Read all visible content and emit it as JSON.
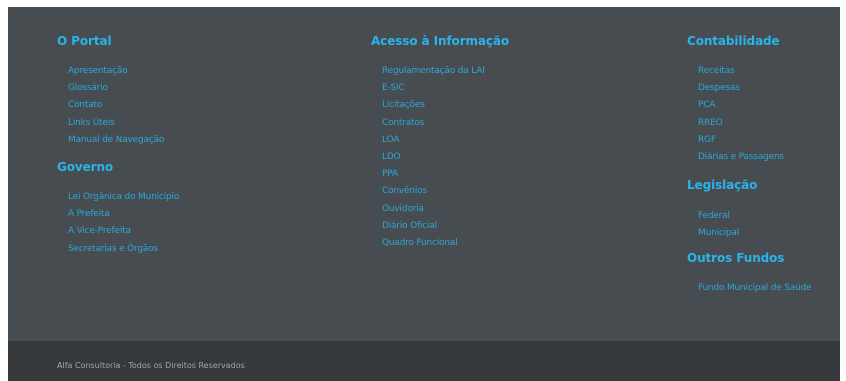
{
  "columns": [
    {
      "sections": [
        {
          "title": "O Portal",
          "links": [
            "Apresentação",
            "Glossário",
            "Contato",
            "Links Úteis",
            "Manual de Navegação"
          ]
        },
        {
          "title": "Governo",
          "links": [
            "Lei Orgânica do Município",
            "A Prefeita",
            "A Vice-Prefeita",
            "Secretarias e Órgãos"
          ]
        }
      ]
    },
    {
      "sections": [
        {
          "title": "Acesso à Informação",
          "links": [
            "Regulamentação da LAI",
            "E-SIC",
            "Licitações",
            "Contratos",
            "LOA",
            "LDO",
            "PPA",
            "Convênios",
            "Ouvidoria",
            "Diário Oficial",
            "Quadro Funcional"
          ]
        }
      ]
    },
    {
      "sections": [
        {
          "title": "Contabilidade",
          "links": [
            "Receitas",
            "Despesas",
            "PCA",
            "RREO",
            "RGF",
            "Diárias e Passagens"
          ]
        },
        {
          "title": "Legislação",
          "links": [
            "Federal",
            "Municipal"
          ]
        },
        {
          "title": "Outros Fundos",
          "links": [
            "Fundo Municipal de Saúde"
          ]
        }
      ]
    }
  ],
  "footer": {
    "copyright": "Alfa Consultoria - Todos os Direitos Reservados"
  },
  "colors": {
    "heading": "#2bb3ea",
    "link": "#2fa6d8",
    "background": "#464c4f",
    "bottom_bar": "#35393c"
  }
}
